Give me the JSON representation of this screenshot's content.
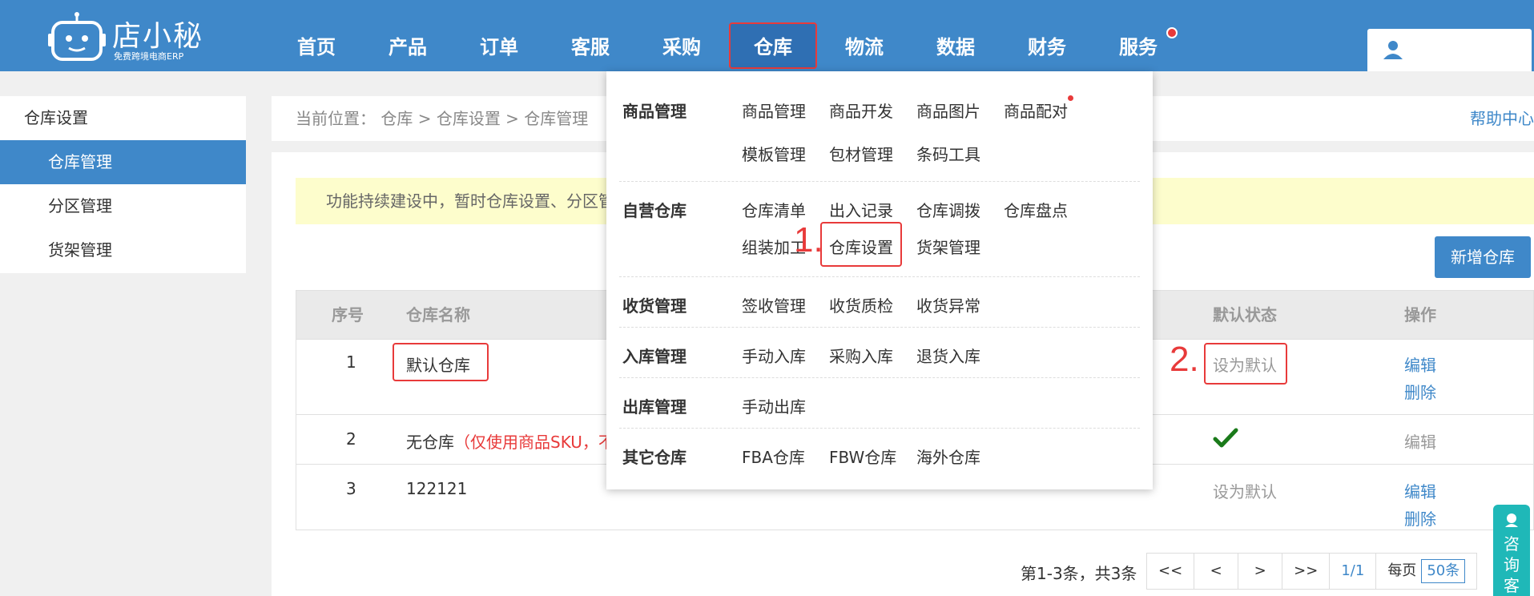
{
  "header": {
    "logo_title": "店小秘",
    "logo_subtitle": "免费跨境电商ERP",
    "nav": [
      "首页",
      "产品",
      "订单",
      "客服",
      "采购",
      "仓库",
      "物流",
      "数据",
      "财务",
      "服务"
    ],
    "active_nav": "仓库",
    "brand_color": "#3f88c9",
    "accent_red": "#e83a3a"
  },
  "sidebar": {
    "heading": "仓库设置",
    "items": [
      "仓库管理",
      "分区管理",
      "货架管理"
    ],
    "active": "仓库管理"
  },
  "breadcrumb": {
    "text": "当前位置： 仓库 > 仓库设置 > 仓库管理"
  },
  "help_center": "帮助中心",
  "notice": "功能持续建设中，暂时仓库设置、分区管",
  "add_button": "新增仓库",
  "table": {
    "headers": [
      "序号",
      "仓库名称",
      "默认状态",
      "操作"
    ],
    "rows": [
      {
        "no": "1",
        "name": "默认仓库",
        "note": "",
        "status": "设为默认",
        "actions": [
          "编辑",
          "删除"
        ]
      },
      {
        "no": "2",
        "name": "无仓库",
        "note": "（仅使用商品SKU，不",
        "status": "",
        "actions": [
          "编辑"
        ]
      },
      {
        "no": "3",
        "name": "122121",
        "note": "",
        "status": "设为默认",
        "actions": [
          "编辑",
          "删除"
        ]
      }
    ]
  },
  "pagination": {
    "info": "第1-3条，共3条",
    "buttons": [
      "<<",
      "<",
      ">",
      ">>"
    ],
    "current": "1/1",
    "per_page_label": "每页",
    "per_page_value": "50条"
  },
  "consult": "咨询客服",
  "steps": [
    "1.",
    "2."
  ],
  "dropdown": {
    "sections": [
      {
        "title": "商品管理",
        "items": [
          "商品管理",
          "商品开发",
          "商品图片",
          "商品配对",
          "模板管理",
          "包材管理",
          "条码工具"
        ]
      },
      {
        "title": "自营仓库",
        "items": [
          "仓库清单",
          "出入记录",
          "仓库调拨",
          "仓库盘点",
          "组装加工",
          "仓库设置",
          "货架管理"
        ]
      },
      {
        "title": "收货管理",
        "items": [
          "签收管理",
          "收货质检",
          "收货异常"
        ]
      },
      {
        "title": "入库管理",
        "items": [
          "手动入库",
          "采购入库",
          "退货入库"
        ]
      },
      {
        "title": "出库管理",
        "items": [
          "手动出库"
        ]
      },
      {
        "title": "其它仓库",
        "items": [
          "FBA仓库",
          "FBW仓库",
          "海外仓库"
        ]
      }
    ]
  }
}
